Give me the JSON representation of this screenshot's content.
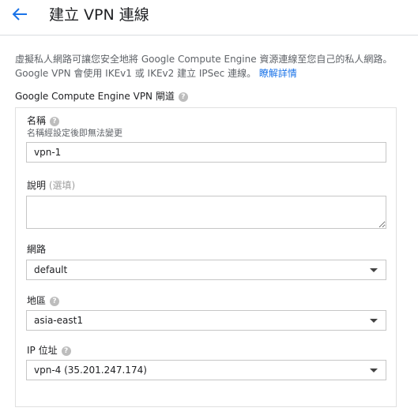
{
  "header": {
    "title": "建立 VPN 連線"
  },
  "intro": {
    "text": "虛擬私人網路可讓您安全地將 Google Compute Engine 資源連線至您自己的私人網路。Google VPN 會使用 IKEv1 或 IKEv2 建立 IPSec 連線。",
    "link": "瞭解詳情"
  },
  "section": {
    "title": "Google Compute Engine VPN 閘道"
  },
  "form": {
    "name": {
      "label": "名稱",
      "hint": "名稱經設定後即無法變更",
      "value": "vpn-1"
    },
    "description": {
      "label": "說明",
      "optional": "(選填)",
      "value": ""
    },
    "network": {
      "label": "網路",
      "value": "default"
    },
    "region": {
      "label": "地區",
      "value": "asia-east1"
    },
    "ip": {
      "label": "IP 位址",
      "value": "vpn-4 (35.201.247.174)"
    }
  },
  "colors": {
    "accent": "#1a73e8",
    "help_icon": "#bdbdbd",
    "border": "#c6c6c6"
  }
}
